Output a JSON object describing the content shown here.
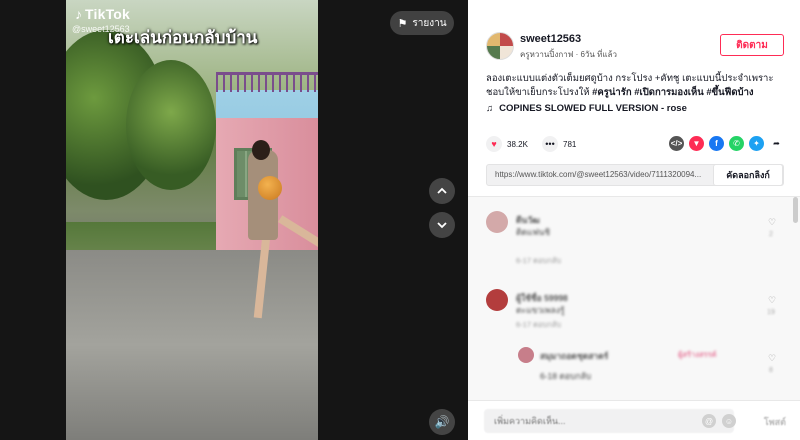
{
  "video": {
    "brand": "TikTok",
    "handle_overlay": "@sweet12563",
    "caption_overlay": "เตะเล่นก่อนกลับบ้าน",
    "report_label": "รายงาน"
  },
  "author": {
    "username": "sweet12563",
    "display_name": "ครูหวานปิ้งกาฟ",
    "posted": "6วัน ที่แล้ว"
  },
  "follow_label": "ติดตาม",
  "description": {
    "text": "ลองเตะแบบแต่งตัวเต็มยศดูบ้าง กระโปรง +คัทชู เตะแบบนี้ประจำเพราะชอบให้ขาเย็บกระโปรงให้ ",
    "tags": [
      "#ครูน่ารัก",
      "#เปิดการมองเห็น",
      "#ขึ้นฟีดบ้าง"
    ]
  },
  "music": {
    "icon": "music-note-icon",
    "title": "COPINES SLOWED FULL VERSION - rose"
  },
  "stats": {
    "likes": "38.2K",
    "comments": "781"
  },
  "share_icons": [
    {
      "name": "embed-icon",
      "glyph": "</>",
      "color": "#555555"
    },
    {
      "name": "send-icon",
      "glyph": "▼",
      "color": "#fe2c55"
    },
    {
      "name": "facebook-icon",
      "glyph": "f",
      "color": "#1877f2"
    },
    {
      "name": "whatsapp-icon",
      "glyph": "✆",
      "color": "#25d366"
    },
    {
      "name": "twitter-icon",
      "glyph": "✦",
      "color": "#1da1f2"
    },
    {
      "name": "share-arrow-icon",
      "glyph": "➦",
      "color": "#161823"
    }
  ],
  "link": {
    "url": "https://www.tiktok.com/@sweet12563/video/7111320094...",
    "copy_label": "คัดลอกลิงก์"
  },
  "comments": [
    {
      "name": "ดีนวัฒ",
      "text": "ติดแฟนชิ",
      "meta": "6-17 ตอบกลับ",
      "likes": "2"
    },
    {
      "name": "ผู้ใช้ชื่อ 59998",
      "text": "ตะแขวเพลงรู้",
      "meta": "6-17 ตอบกลับ",
      "likes": "19"
    },
    {
      "name": "สมุมาถอดชุดสาดร์",
      "text": "ผู้สร้างสรรค์",
      "meta": "6-18 ตอบกลับ",
      "likes": "8"
    }
  ],
  "comment_input": {
    "placeholder": "เพิ่มความคิดเห็น...",
    "post_label": "โพสต์"
  },
  "colors": {
    "accent": "#fe2c55",
    "text": "#161823"
  }
}
